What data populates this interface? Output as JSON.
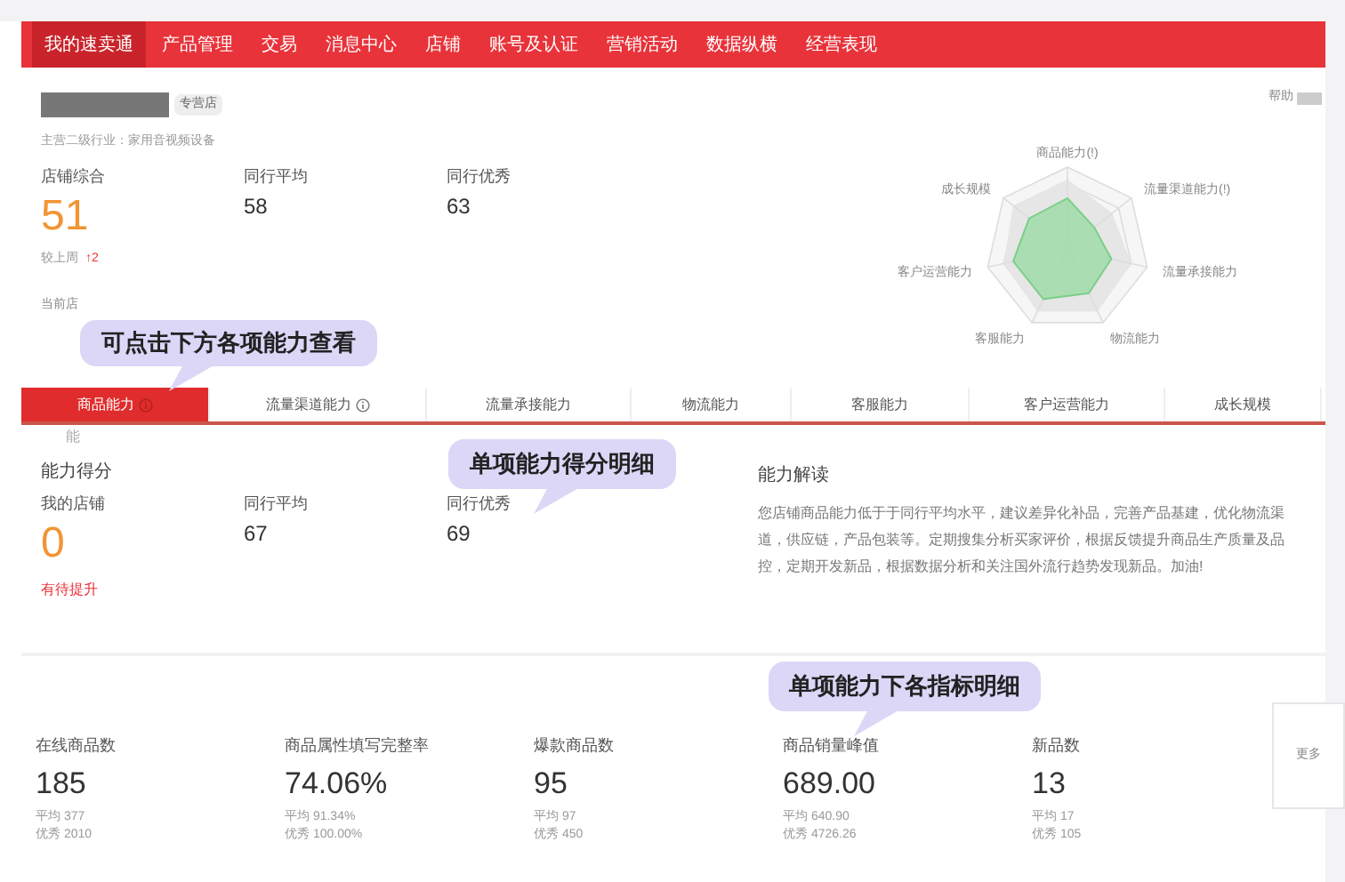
{
  "nav": [
    {
      "label": "我的速卖通",
      "selected": true
    },
    {
      "label": "产品管理",
      "selected": false
    },
    {
      "label": "交易",
      "selected": false
    },
    {
      "label": "消息中心",
      "selected": false
    },
    {
      "label": "店铺",
      "selected": false
    },
    {
      "label": "账号及认证",
      "selected": false
    },
    {
      "label": "营销活动",
      "selected": false
    },
    {
      "label": "数据纵横",
      "selected": false
    },
    {
      "label": "经营表现",
      "selected": false
    }
  ],
  "help": "帮助",
  "store": {
    "badge": "专营店",
    "industry": "主营二级行业：家用音视频设备",
    "stats": [
      {
        "label": "店铺综合",
        "value": "51",
        "kind": "main"
      },
      {
        "label": "同行平均",
        "value": "58",
        "kind": "peer"
      },
      {
        "label": "同行优秀",
        "value": "63",
        "kind": "peer"
      }
    ],
    "change_label": "较上周",
    "change": "↑2",
    "note": "当前店"
  },
  "radar": {
    "labels": [
      "商品能力(!)",
      "流量渠道能力(!)",
      "流量承接能力",
      "物流能力",
      "客服能力",
      "客户运营能力",
      "成长规模"
    ]
  },
  "callouts": [
    "可点击下方各项能力查看",
    "单项能力得分明细",
    "单项能力下各指标明细"
  ],
  "tabs": [
    {
      "label": "商品能力",
      "selected": true,
      "info": true
    },
    {
      "label": "流量渠道能力",
      "selected": false,
      "info": true
    },
    {
      "label": "流量承接能力",
      "selected": false,
      "info": false
    },
    {
      "label": "物流能力",
      "selected": false,
      "info": false
    },
    {
      "label": "客服能力",
      "selected": false,
      "info": false
    },
    {
      "label": "客户运营能力",
      "selected": false,
      "info": false
    },
    {
      "label": "成长规模",
      "selected": false,
      "info": false
    }
  ],
  "stray": "能",
  "score": {
    "title": "能力得分",
    "stats": [
      {
        "label": "我的店铺",
        "value": "0",
        "kind": "main"
      },
      {
        "label": "同行平均",
        "value": "67",
        "kind": "peer"
      },
      {
        "label": "同行优秀",
        "value": "69",
        "kind": "peer"
      }
    ],
    "status": "有待提升"
  },
  "reading": {
    "title": "能力解读",
    "text": "您店铺商品能力低于于同行平均水平，建议差异化补品，完善产品基建，优化物流渠道，供应链，产品包装等。定期搜集分析买家评价，根据反馈提升商品生产质量及品控，定期开发新品，根据数据分析和关注国外流行趋势发现新品。加油!"
  },
  "metrics": [
    {
      "label": "在线商品数",
      "value": "185",
      "average": "平均 377",
      "excellent": "优秀 2010"
    },
    {
      "label": "商品属性填写完整率",
      "value": "74.06%",
      "average": "平均 91.34%",
      "excellent": "优秀 100.00%"
    },
    {
      "label": "爆款商品数",
      "value": "95",
      "average": "平均 97",
      "excellent": "优秀 450"
    },
    {
      "label": "商品销量峰值",
      "value": "689.00",
      "average": "平均 640.90",
      "excellent": "优秀 4726.26"
    },
    {
      "label": "新品数",
      "value": "13",
      "average": "平均 17",
      "excellent": "优秀 105"
    }
  ],
  "more": "更多"
}
